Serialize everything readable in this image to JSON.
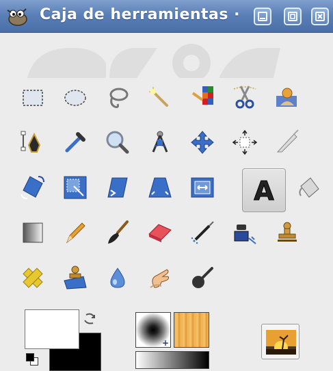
{
  "window": {
    "title": "Caja de herramientas ·",
    "buttons": [
      "minimize",
      "maximize",
      "close"
    ]
  },
  "tools": [
    {
      "name": "rect-select-tool",
      "icon": "rectangle-select-icon"
    },
    {
      "name": "ellipse-select-tool",
      "icon": "ellipse-select-icon"
    },
    {
      "name": "free-select-tool",
      "icon": "lasso-icon"
    },
    {
      "name": "fuzzy-select-tool",
      "icon": "magic-wand-icon"
    },
    {
      "name": "color-select-tool",
      "icon": "select-by-color-icon"
    },
    {
      "name": "scissors-tool",
      "icon": "scissors-icon"
    },
    {
      "name": "foreground-select-tool",
      "icon": "foreground-select-icon"
    },
    {
      "name": "paths-tool",
      "icon": "paths-pen-icon"
    },
    {
      "name": "color-picker-tool",
      "icon": "color-picker-icon"
    },
    {
      "name": "zoom-tool",
      "icon": "magnifier-icon"
    },
    {
      "name": "measure-tool",
      "icon": "compass-icon"
    },
    {
      "name": "move-tool",
      "icon": "move-icon"
    },
    {
      "name": "align-tool",
      "icon": "align-icon"
    },
    {
      "name": "crop-tool",
      "icon": "crop-knife-icon"
    },
    {
      "name": "rotate-tool",
      "icon": "rotate-icon"
    },
    {
      "name": "scale-tool",
      "icon": "scale-icon"
    },
    {
      "name": "shear-tool",
      "icon": "shear-icon"
    },
    {
      "name": "perspective-tool",
      "icon": "perspective-icon"
    },
    {
      "name": "flip-tool",
      "icon": "flip-icon"
    },
    {
      "name": "text-tool",
      "icon": "text-icon"
    },
    {
      "name": "bucket-fill-tool",
      "icon": "bucket-icon"
    },
    {
      "name": "blend-tool",
      "icon": "gradient-icon"
    },
    {
      "name": "pencil-tool",
      "icon": "pencil-icon"
    },
    {
      "name": "paintbrush-tool",
      "icon": "paintbrush-icon"
    },
    {
      "name": "eraser-tool",
      "icon": "eraser-icon"
    },
    {
      "name": "airbrush-tool",
      "icon": "airbrush-icon"
    },
    {
      "name": "ink-tool",
      "icon": "ink-icon"
    },
    {
      "name": "clone-tool",
      "icon": "clone-stamp-icon"
    },
    {
      "name": "heal-tool",
      "icon": "heal-bandage-icon"
    },
    {
      "name": "perspective-clone-tool",
      "icon": "perspective-clone-icon"
    },
    {
      "name": "blur-sharpen-tool",
      "icon": "blur-drop-icon"
    },
    {
      "name": "smudge-tool",
      "icon": "smudge-finger-icon"
    },
    {
      "name": "dodge-burn-tool",
      "icon": "dodge-burn-icon"
    }
  ],
  "active_tool": "text-tool",
  "colors": {
    "foreground": "#ffffff",
    "background": "#000000",
    "title_bar": "#5b80b8",
    "window_bg": "#ececec"
  },
  "text_tool_glyph": "A"
}
